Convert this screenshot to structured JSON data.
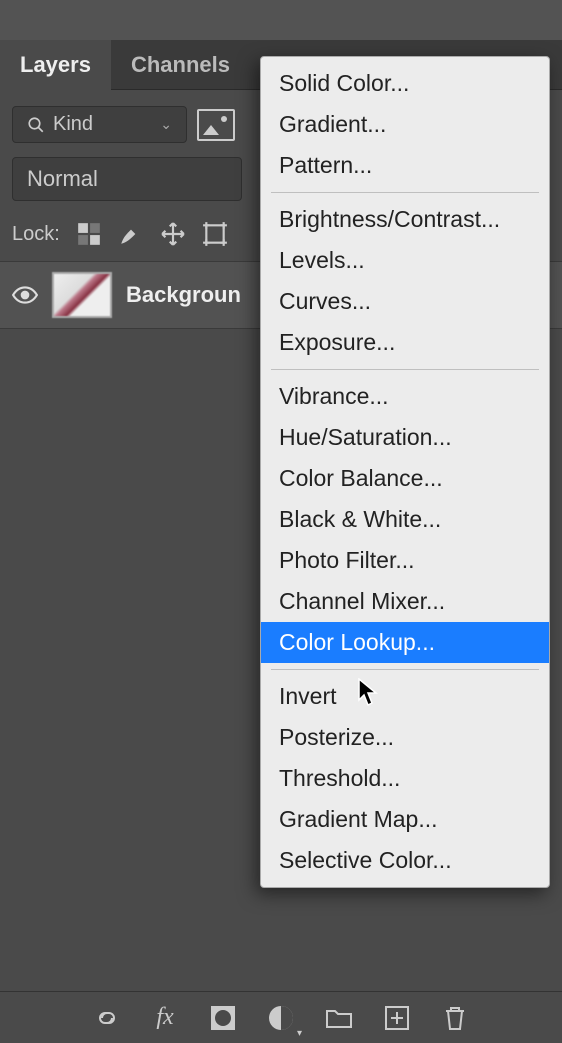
{
  "tabs": {
    "layers": "Layers",
    "channels": "Channels"
  },
  "filter": {
    "label": "Kind"
  },
  "blend": {
    "mode": "Normal"
  },
  "lock": {
    "label": "Lock:"
  },
  "layer": {
    "name": "Backgroun"
  },
  "menu": {
    "group1": [
      "Solid Color...",
      "Gradient...",
      "Pattern..."
    ],
    "group2": [
      "Brightness/Contrast...",
      "Levels...",
      "Curves...",
      "Exposure..."
    ],
    "group3": [
      "Vibrance...",
      "Hue/Saturation...",
      "Color Balance...",
      "Black & White...",
      "Photo Filter...",
      "Channel Mixer...",
      "Color Lookup..."
    ],
    "group4": [
      "Invert",
      "Posterize...",
      "Threshold...",
      "Gradient Map...",
      "Selective Color..."
    ],
    "highlighted": "Color Lookup..."
  }
}
